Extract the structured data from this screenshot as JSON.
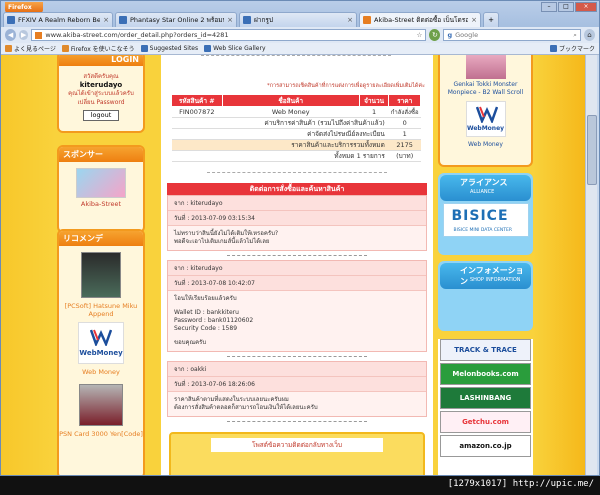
{
  "browser": {
    "menu_button": "Firefox",
    "tabs": [
      {
        "label": "FFXIV A Realm Reborn Beta : Tonberr...",
        "favicon": "blue"
      },
      {
        "label": "Phantasy Star Online 2 พร้อมทดลอง...",
        "favicon": "blue"
      },
      {
        "label": "ฝากรูป",
        "favicon": "blue"
      },
      {
        "label": "Akiba-Street ติดต่อซื้อ เบ็นโดรอย์ ...",
        "favicon": "orange",
        "active": true
      }
    ],
    "url": "www.akiba-street.com/order_detail.php?orders_id=4281",
    "search_placeholder": "Google",
    "bookmarks": [
      "よく見るページ",
      "Firefox を使いこなそう",
      "Suggested Sites",
      "Web Slice Gallery"
    ],
    "bookmarks_right": "ブックマーク"
  },
  "left": {
    "login_header": "LOGIN",
    "welcome": "สวัสดีครับคุณ",
    "username": "kiterudayo",
    "change_pw_line1": "คุณได้เข้าสู่ระบบแล้วครับ",
    "change_pw_line2": "เปลี่ยน Password",
    "logout": "logout",
    "sponsor_header": "スポンサー",
    "sponsor_caption": "Akiba-Street",
    "reco_header": "リコメンデ",
    "item1": "[PCSoft] Hatsune Miku Append",
    "webmoney": "WebMoney",
    "item2": "Web Money",
    "item3": "PSN Card 3000 Yen[Code]"
  },
  "main": {
    "note": "*การสามารถเช็คสินค้าที่การแต่งการเพื่อดูรายละเอียดเพิ่มเติมได้ค่ะ",
    "headers": [
      "รหัสสินค้า #",
      "ชื่อสินค้า",
      "จำนวน",
      "ราคา"
    ],
    "row": {
      "code": "FIN007872",
      "name": "Web Money",
      "qty": "1",
      "price": "กำลังสั่งซื้อ"
    },
    "shipping_label": "ค่าบริการค่าสินค้า (รวมไปถึงค่าสินค้าแล้ว)",
    "shipping_value": "0",
    "ems_label": "ค่าจัดส่งไปรษณีย์ลงทะเบียน",
    "ems_value": "1",
    "total_label": "ราคาสินค้าและบริการรวมทั้งหมด",
    "total_value": "2175",
    "count_label": "ทั้งหมด 1 รายการ",
    "count_value": "(บาท)",
    "section": "ติดต่อการสั่งซื้อและค้นหาสินค้า",
    "messages": [
      {
        "from": "จาก : kiterudayo",
        "date": "วันที่ : 2013-07-09 03:15:34",
        "body": [
          "ไม่ทราบว่าสินนี้ยังไม่ได้เติมให้เหรอครับ?",
          "พอดีจะเอาไปเติมเกมส์นี้แล้วไม่ได้เลย"
        ]
      },
      {
        "from": "จาก : kiterudayo",
        "date": "วันที่ : 2013-07-08 10:42:07",
        "body": [
          "โอนให้เรียบร้อยแล้วครับ",
          "",
          "Wallet ID : bankkiteru",
          "Password : bank01120602",
          "Security Code : 1589",
          "",
          "ขอบคุณครับ"
        ]
      },
      {
        "from": "จาก : oakki",
        "date": "วันที่ : 2013-07-06 18:26:06",
        "body": [
          "ราคาสินค้าตามที่แสดงในระบบเลยนะครับผม",
          "ต้องการสั่งสินค้าตลอดก็สามารถโอนเงินให้ได้เลยนะครับ"
        ]
      }
    ],
    "contact_box": "โพสต์ข้อความติดต่อกลับทางเว็บ"
  },
  "right": {
    "item1": "Genkai Tokki Monster Monpiece - B2 Wall Scroll",
    "webmoney": "WebMoney",
    "item2": "Web Money",
    "alliance": "アライアンス",
    "alliance_sub": "ALLIANCE",
    "bisice": "BISICE",
    "bisice_sub": "BISICE MINI DATA CENTER",
    "shop_info": "インフォメーション",
    "shop_info_sub": "SHOP INFORMATION",
    "banners": [
      "TRACK & TRACE",
      "Melonbooks.com",
      "LASHINBANG",
      "Getchu.com",
      "amazon.co.jp"
    ]
  },
  "status": "[1279x1017] http://upic.me/"
}
